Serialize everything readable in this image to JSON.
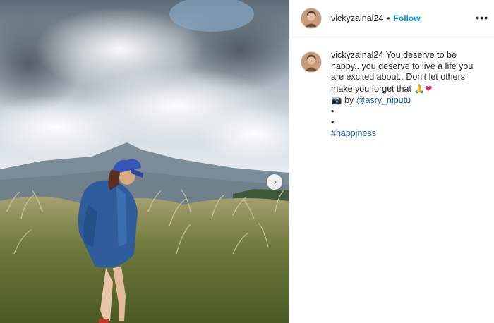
{
  "post": {
    "username": "vickyzainal24",
    "separator": "•",
    "follow_label": "Follow",
    "more_label": "•••",
    "next_label": "›",
    "caption": {
      "username": "vickyzainal24",
      "text": "You deserve to be happy.. you deserve to live a life you are excited about.. Don't let others make you forget that",
      "emoji_pray": "🙏",
      "emoji_heart": "❤",
      "camera_emoji": "📷",
      "credit_prefix": "by",
      "credit_mention": "@asry_niputu",
      "bullet1": "•",
      "bullet2": "•",
      "hashtag": "#happiness"
    }
  },
  "colors": {
    "follow": "#0095f6",
    "link": "#1d5fa8",
    "heart": "#e0245e"
  },
  "icons": {
    "next": "chevron-right-icon",
    "more": "more-horizontal-icon",
    "avatar": "avatar"
  }
}
